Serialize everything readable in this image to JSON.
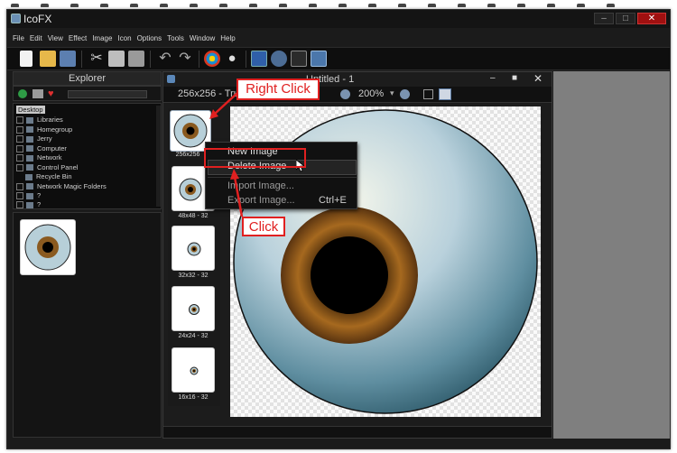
{
  "app": {
    "title": "IcoFX",
    "window_buttons": [
      "–",
      "□",
      "✕"
    ]
  },
  "menu": [
    "File",
    "Edit",
    "View",
    "Effect",
    "Image",
    "Icon",
    "Options",
    "Tools",
    "Window",
    "Help"
  ],
  "explorer": {
    "title": "Explorer",
    "tree": [
      {
        "label": "Desktop",
        "selected": true
      },
      {
        "label": "Libraries"
      },
      {
        "label": "Homegroup"
      },
      {
        "label": "Jerry"
      },
      {
        "label": "Computer"
      },
      {
        "label": "Network"
      },
      {
        "label": "Control Panel"
      },
      {
        "label": "Recycle Bin"
      },
      {
        "label": "Network Magic Folders"
      },
      {
        "label": "?"
      },
      {
        "label": "?"
      }
    ]
  },
  "document": {
    "title": "Untitled - 1",
    "size_label": "256x256 - Tru",
    "zoom": "200%",
    "images": [
      {
        "label": "256x256",
        "size": "large"
      },
      {
        "label": "48x48 - 32",
        "size": "medium"
      },
      {
        "label": "32x32 - 32",
        "size": "small"
      },
      {
        "label": "24x24 - 32",
        "size": "small"
      },
      {
        "label": "16x16 - 32",
        "size": "tiny"
      }
    ]
  },
  "context_menu": {
    "items": [
      {
        "label": "New Image",
        "shortcut": ""
      },
      {
        "label": "Delete Image",
        "shortcut": "",
        "highlighted": true
      },
      {
        "label": "Import Image...",
        "shortcut": ""
      },
      {
        "label": "Export Image...",
        "shortcut": "Ctrl+E"
      }
    ]
  },
  "annotations": {
    "right_click": "Right Click",
    "click": "Click"
  },
  "colors": {
    "callout": "#e02020",
    "window_bg": "#1b1b1b",
    "accent_close": "#a01010"
  }
}
